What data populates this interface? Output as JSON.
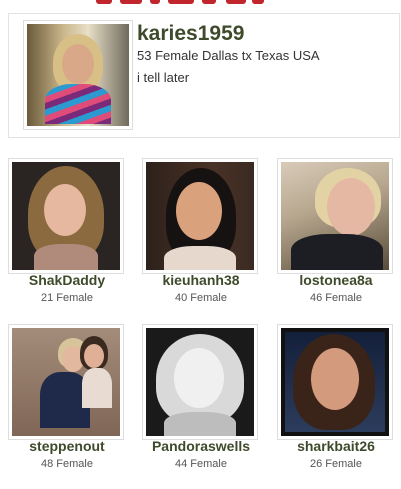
{
  "profile": {
    "username": "karies1959",
    "info": "53 Female Dallas tx Texas USA",
    "status": "i tell later"
  },
  "members": [
    {
      "name": "ShakDaddy",
      "info": "21 Female"
    },
    {
      "name": "kieuhanh38",
      "info": "40 Female"
    },
    {
      "name": "lostonea8a",
      "info": "46 Female"
    },
    {
      "name": "steppenout",
      "info": "48 Female"
    },
    {
      "name": "Pandoraswells",
      "info": "44 Female"
    },
    {
      "name": "sharkbait26",
      "info": "26 Female"
    }
  ],
  "colors": {
    "accent_red": "#c0262c",
    "username_green": "#3e4a2a"
  }
}
